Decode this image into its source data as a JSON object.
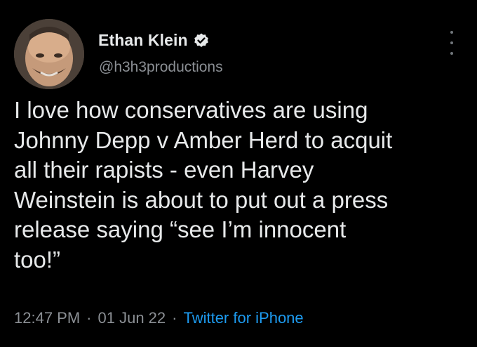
{
  "user": {
    "display_name": "Ethan Klein",
    "handle": "@h3h3productions",
    "verified": true
  },
  "tweet": {
    "text": "I love how conservatives are using\nJohnny Depp v Amber Herd to acquit\nall their rapists - even Harvey\nWeinstein is about to put out a press\nrelease saying “see I’m innocent\ntoo!”",
    "time": "12:47 PM",
    "separator": "·",
    "date": "01 Jun 22",
    "source": "Twitter for iPhone"
  },
  "icons": {
    "verified": "verified-badge-icon",
    "more": "more-options-icon"
  },
  "colors": {
    "background": "#000000",
    "text": "#e7e9ea",
    "secondary": "#8b8f94",
    "link": "#1d9bf0"
  }
}
